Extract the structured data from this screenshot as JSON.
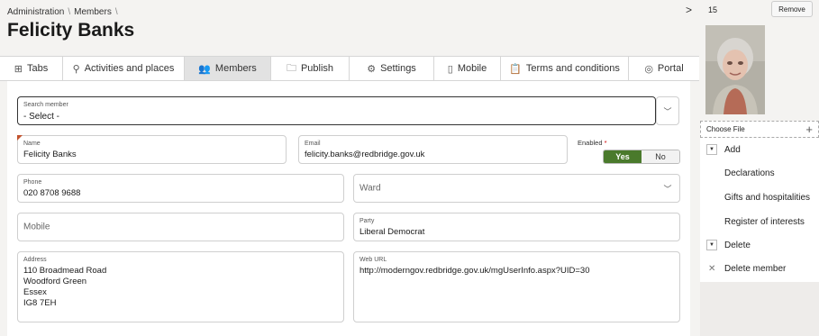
{
  "header": {
    "breadcrumb": [
      "Administration",
      "Members"
    ],
    "title": "Felicity Banks"
  },
  "tabs": [
    {
      "label": "Tabs",
      "icon": "table-icon",
      "glyph": "⊞",
      "active": false
    },
    {
      "label": "Activities and places",
      "icon": "location-pin-icon",
      "glyph": "⚲",
      "active": false
    },
    {
      "label": "Members",
      "icon": "users-icon",
      "glyph": "👥",
      "active": true
    },
    {
      "label": "Publish",
      "icon": "folder-icon",
      "glyph": "🗀",
      "active": false
    },
    {
      "label": "Settings",
      "icon": "gears-icon",
      "glyph": "⚙",
      "active": false
    },
    {
      "label": "Mobile",
      "icon": "mobile-icon",
      "glyph": "▯",
      "active": false
    },
    {
      "label": "Terms and conditions",
      "icon": "clipboard-icon",
      "glyph": "📋",
      "active": false
    },
    {
      "label": "Portal",
      "icon": "compass-icon",
      "glyph": "◎",
      "active": false
    }
  ],
  "form": {
    "search": {
      "label": "Search member",
      "value": "- Select -"
    },
    "name": {
      "label": "Name",
      "value": "Felicity Banks"
    },
    "email": {
      "label": "Email",
      "value": "felicity.banks@redbridge.gov.uk"
    },
    "enabled": {
      "label": "Enabled",
      "required_mark": "*",
      "yes": "Yes",
      "no": "No",
      "value": "Yes"
    },
    "phone": {
      "label": "Phone",
      "value": "020 8708 9688"
    },
    "ward": {
      "placeholder": "Ward"
    },
    "mobile": {
      "placeholder": "Mobile"
    },
    "party": {
      "label": "Party",
      "value": "Liberal Democrat"
    },
    "address": {
      "label": "Address",
      "value": "110 Broadmead Road\nWoodford Green\nEssex\nIG8 7EH"
    },
    "web_url": {
      "label": "Web URL",
      "value": "http://moderngov.redbridge.gov.uk/mgUserInfo.aspx?UID=30"
    }
  },
  "sidebar": {
    "collapse_glyph": ">",
    "count": "15",
    "remove_label": "Remove",
    "choose_file_label": "Choose File",
    "add_group": {
      "label": "Add",
      "items": [
        "Declarations",
        "Gifts and hospitalities",
        "Register of interests"
      ]
    },
    "delete_group": {
      "label": "Delete",
      "items": [
        "Delete member"
      ]
    }
  },
  "colors": {
    "accent_green": "#4a7a2c",
    "required_red": "#c00000"
  }
}
